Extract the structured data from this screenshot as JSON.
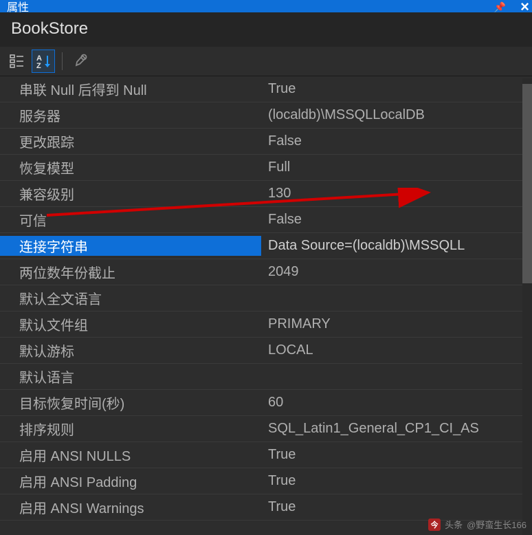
{
  "titleBar": {
    "title": "属性"
  },
  "header": {
    "objectName": "BookStore"
  },
  "properties": [
    {
      "name": "串联 Null 后得到 Null",
      "value": "True",
      "selected": false
    },
    {
      "name": "服务器",
      "value": "(localdb)\\MSSQLLocalDB",
      "selected": false
    },
    {
      "name": "更改跟踪",
      "value": "False",
      "selected": false
    },
    {
      "name": "恢复模型",
      "value": "Full",
      "selected": false
    },
    {
      "name": "兼容级别",
      "value": "130",
      "selected": false
    },
    {
      "name": "可信",
      "value": "False",
      "selected": false
    },
    {
      "name": "连接字符串",
      "value": "Data Source=(localdb)\\MSSQLL",
      "selected": true
    },
    {
      "name": "两位数年份截止",
      "value": "2049",
      "selected": false
    },
    {
      "name": "默认全文语言",
      "value": "",
      "selected": false
    },
    {
      "name": "默认文件组",
      "value": "PRIMARY",
      "selected": false
    },
    {
      "name": "默认游标",
      "value": "LOCAL",
      "selected": false
    },
    {
      "name": "默认语言",
      "value": "",
      "selected": false
    },
    {
      "name": "目标恢复时间(秒)",
      "value": "60",
      "selected": false
    },
    {
      "name": "排序规则",
      "value": "SQL_Latin1_General_CP1_CI_AS",
      "selected": false
    },
    {
      "name": "启用 ANSI NULLS",
      "value": "True",
      "selected": false
    },
    {
      "name": "启用 ANSI Padding",
      "value": "True",
      "selected": false
    },
    {
      "name": "启用 ANSI Warnings",
      "value": "True",
      "selected": false
    }
  ],
  "watermark": {
    "label": "头条",
    "author": "@野蛮生长166"
  }
}
